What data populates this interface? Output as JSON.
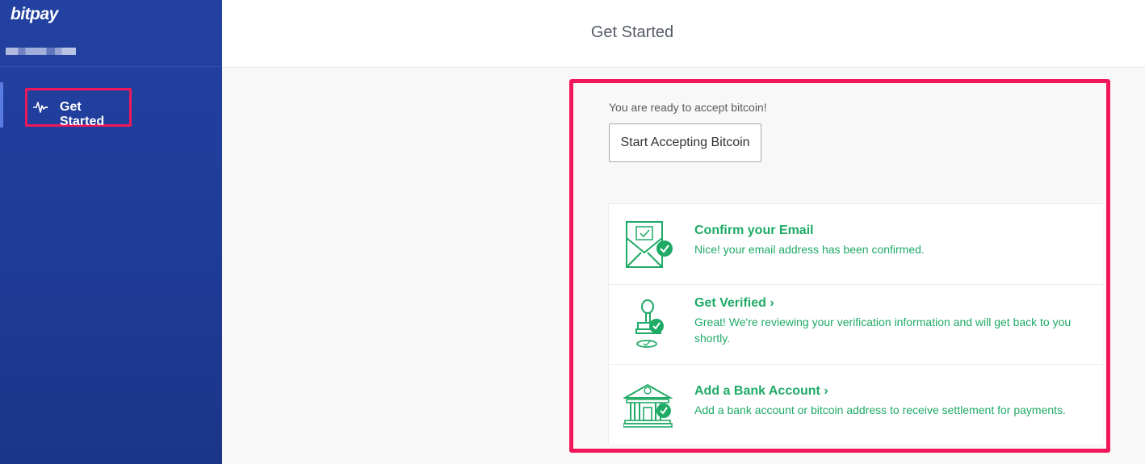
{
  "sidebar": {
    "logo": "bitpay",
    "items": [
      {
        "label": "Get Started",
        "icon": "activity-pulse-icon",
        "active": true
      }
    ]
  },
  "header": {
    "title": "Get Started"
  },
  "main": {
    "ready_text": "You are ready to accept bitcoin!",
    "start_button_label": "Start Accepting Bitcoin",
    "steps": [
      {
        "icon": "envelope-check-icon",
        "title": "Confirm your Email",
        "description": "Nice! your email address has been confirmed."
      },
      {
        "icon": "stamp-check-icon",
        "title": "Get Verified ›",
        "description": "Great! We're reviewing your verification information and will get back to you shortly."
      },
      {
        "icon": "bank-check-icon",
        "title": "Add a Bank Account ›",
        "description": "Add a bank account or bitcoin address to receive settlement for payments."
      }
    ]
  },
  "colors": {
    "sidebar": "#1f3c98",
    "accent_green": "#1faa66",
    "highlight": "#f0185a"
  }
}
